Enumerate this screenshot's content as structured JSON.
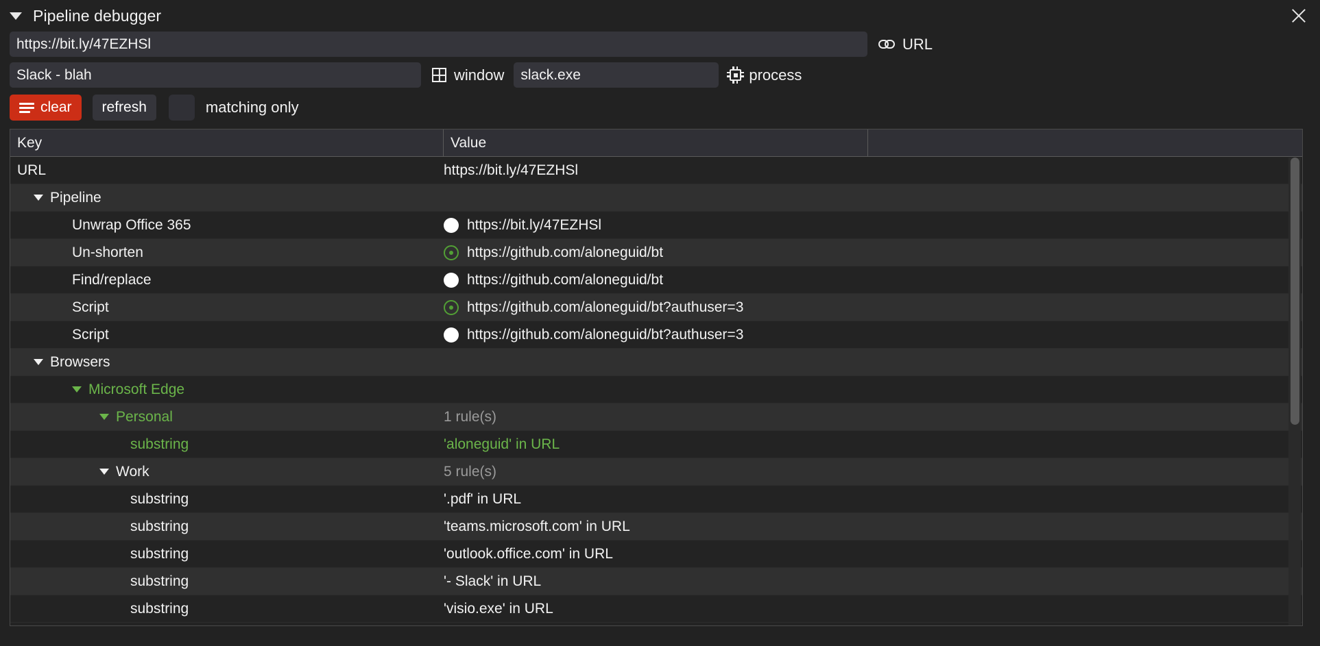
{
  "window": {
    "title": "Pipeline debugger",
    "close_icon": "close-icon",
    "disclosure_icon": "triangle-down-icon"
  },
  "inputs": {
    "url": {
      "value": "https://bit.ly/47EZHSl",
      "label": "URL",
      "icon": "link-icon"
    },
    "window": {
      "value": "Slack - blah",
      "label": "window",
      "icon": "window-grid-icon"
    },
    "process": {
      "value": "slack.exe",
      "label": "process",
      "icon": "chip-icon"
    }
  },
  "toolbar": {
    "clear_label": "clear",
    "clear_icon": "bars-icon",
    "clear_color": "#cc2e16",
    "refresh_label": "refresh",
    "matching_only_label": "matching only",
    "matching_only_checked": false
  },
  "table": {
    "columns": [
      "Key",
      "Value"
    ],
    "rows": [
      {
        "indent": 0,
        "key": "URL",
        "value": "https://bit.ly/47EZHSl",
        "color": "white",
        "tri": false,
        "dot": "none"
      },
      {
        "indent": 1,
        "key": "Pipeline",
        "value": "",
        "color": "white",
        "tri": true,
        "dot": "none"
      },
      {
        "indent": 2,
        "key": "Unwrap Office 365",
        "value": "https://bit.ly/47EZHSl",
        "color": "white",
        "tri": false,
        "dot": "filled"
      },
      {
        "indent": 2,
        "key": "Un-shorten",
        "value": "https://github.com/aloneguid/bt",
        "color": "white",
        "tri": false,
        "dot": "ring"
      },
      {
        "indent": 2,
        "key": "Find/replace",
        "value": "https://github.com/aloneguid/bt",
        "color": "white",
        "tri": false,
        "dot": "filled"
      },
      {
        "indent": 2,
        "key": "Script",
        "value": "https://github.com/aloneguid/bt?authuser=3",
        "color": "white",
        "tri": false,
        "dot": "ring"
      },
      {
        "indent": 2,
        "key": "Script",
        "value": "https://github.com/aloneguid/bt?authuser=3",
        "color": "white",
        "tri": false,
        "dot": "filled"
      },
      {
        "indent": 1,
        "key": "Browsers",
        "value": "",
        "color": "white",
        "tri": true,
        "dot": "none"
      },
      {
        "indent": 2,
        "key": "Microsoft Edge",
        "value": "",
        "color": "green",
        "tri": true,
        "dot": "none"
      },
      {
        "indent": 3,
        "key": "Personal",
        "value": "1 rule(s)",
        "color": "green",
        "value_color": "grey",
        "tri": true,
        "dot": "none"
      },
      {
        "indent": 4,
        "key": "substring",
        "value": "'aloneguid' in URL",
        "color": "green",
        "tri": false,
        "dot": "none"
      },
      {
        "indent": 3,
        "key": "Work",
        "value": "5 rule(s)",
        "color": "white",
        "value_color": "grey",
        "tri": true,
        "dot": "none"
      },
      {
        "indent": 4,
        "key": "substring",
        "value": "'.pdf' in URL",
        "color": "white",
        "tri": false,
        "dot": "none"
      },
      {
        "indent": 4,
        "key": "substring",
        "value": "'teams.microsoft.com' in URL",
        "color": "white",
        "tri": false,
        "dot": "none"
      },
      {
        "indent": 4,
        "key": "substring",
        "value": "'outlook.office.com' in URL",
        "color": "white",
        "tri": false,
        "dot": "none"
      },
      {
        "indent": 4,
        "key": "substring",
        "value": "'- Slack' in URL",
        "color": "white",
        "tri": false,
        "dot": "none"
      },
      {
        "indent": 4,
        "key": "substring",
        "value": "'visio.exe' in URL",
        "color": "white",
        "tri": false,
        "dot": "none"
      }
    ]
  },
  "scrollbar": {
    "thumb_top": 0,
    "thumb_height": 390
  }
}
